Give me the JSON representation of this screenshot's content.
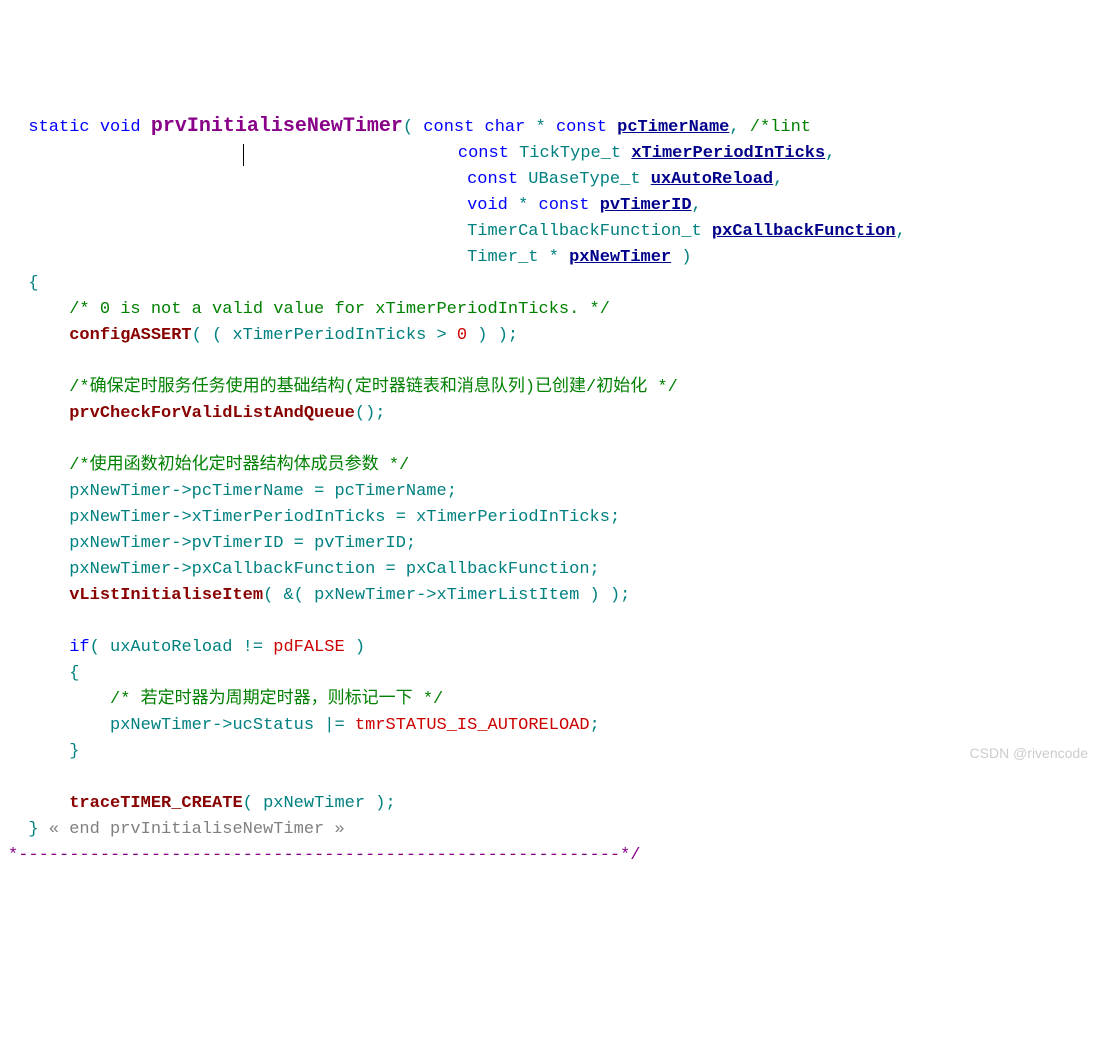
{
  "code": {
    "l1_static": "static",
    "l1_void": "void",
    "l1_fn": "prvInitialiseNewTimer",
    "l1_open": "(",
    "l1_const1": "const",
    "l1_char": "char",
    "l1_star": " * ",
    "l1_const2": "const",
    "l1_p1": "pcTimerName",
    "l1_comma": ",",
    "l1_cmt": " /*lint",
    "l2_const": "const",
    "l2_type": "TickType_t",
    "l2_p": "xTimerPeriodInTicks",
    "l2_comma": ",",
    "l3_const": "const",
    "l3_type": "UBaseType_t",
    "l3_p": "uxAutoReload",
    "l3_comma": ",",
    "l4_void": "void",
    "l4_star": " * ",
    "l4_const": "const",
    "l4_p": "pvTimerID",
    "l4_comma": ",",
    "l5_type": "TimerCallbackFunction_t",
    "l5_p": "pxCallbackFunction",
    "l5_comma": ",",
    "l6_type": "Timer_t",
    "l6_star": " * ",
    "l6_p": "pxNewTimer",
    "l6_close": " )",
    "l7_brace": "{",
    "l8_cmt": "/* 0 is not a valid value for xTimerPeriodInTicks. */",
    "l9_fn": "configASSERT",
    "l9_open": "( ( ",
    "l9_id": "xTimerPeriodInTicks",
    "l9_gt": " > ",
    "l9_zero": "0",
    "l9_close": " ) );",
    "l11_cmt": "/*确保定时服务任务使用的基础结构(定时器链表和消息队列)已创建/初始化 */",
    "l12_fn": "prvCheckForValidListAndQueue",
    "l12_close": "();",
    "l14_cmt": "/*使用函数初始化定时器结构体成员参数 */",
    "l15_id": "pxNewTimer",
    "l15_arrow": "->",
    "l15_m": "pcTimerName",
    "l15_eq": " = ",
    "l15_r": "pcTimerName",
    "l15_semi": ";",
    "l16_id": "pxNewTimer",
    "l16_arrow": "->",
    "l16_m": "xTimerPeriodInTicks",
    "l16_eq": " = ",
    "l16_r": "xTimerPeriodInTicks",
    "l16_semi": ";",
    "l17_id": "pxNewTimer",
    "l17_arrow": "->",
    "l17_m": "pvTimerID",
    "l17_eq": " = ",
    "l17_r": "pvTimerID",
    "l17_semi": ";",
    "l18_id": "pxNewTimer",
    "l18_arrow": "->",
    "l18_m": "pxCallbackFunction",
    "l18_eq": " = ",
    "l18_r": "pxCallbackFunction",
    "l18_semi": ";",
    "l19_fn": "vListInitialiseItem",
    "l19_open": "( &( ",
    "l19_id": "pxNewTimer",
    "l19_arrow": "->",
    "l19_m": "xTimerListItem",
    "l19_close": " ) );",
    "l21_if": "if",
    "l21_open": "( ",
    "l21_id": "uxAutoReload",
    "l21_ne": " != ",
    "l21_mac": "pdFALSE",
    "l21_close": " )",
    "l22_brace": "{",
    "l23_cmt": "/* 若定时器为周期定时器，则标记一下 */",
    "l24_id": "pxNewTimer",
    "l24_arrow": "->",
    "l24_m": "ucStatus",
    "l24_or": " |= ",
    "l24_mac": "tmrSTATUS_IS_AUTORELOAD",
    "l24_semi": ";",
    "l25_brace": "}",
    "l27_fn": "traceTIMER_CREATE",
    "l27_open": "( ",
    "l27_id": "pxNewTimer",
    "l27_close": " );",
    "l28_brace": "}",
    "l28_end": " « end prvInitialiseNewTimer »",
    "l29_dash": "*-----------------------------------------------------------*/"
  },
  "watermark": "CSDN @rivencode"
}
